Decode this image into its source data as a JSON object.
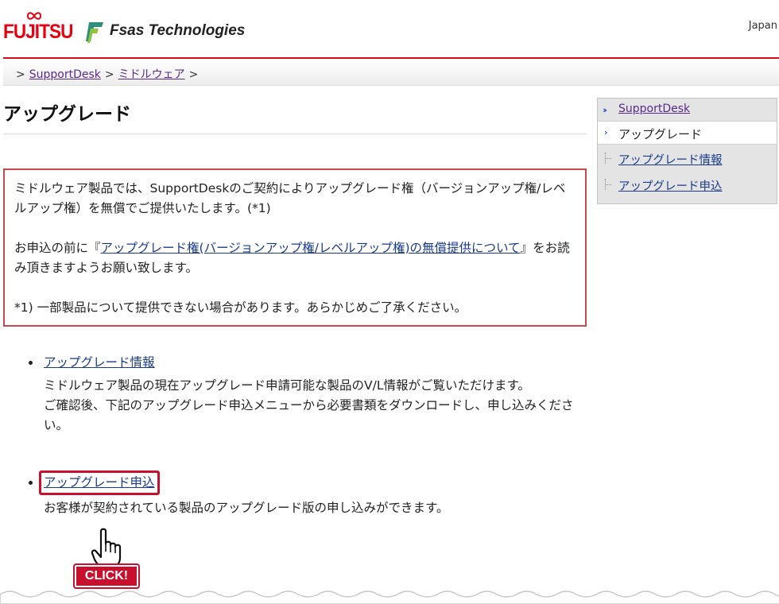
{
  "header": {
    "brand": "FUJITSU",
    "company": "Fsas Technologies",
    "region": "Japan",
    "colors": {
      "brand_red": "#e60012",
      "rule_red": "#d0111b"
    }
  },
  "breadcrumb": {
    "items": [
      {
        "label": "SupportDesk"
      },
      {
        "label": "ミドルウェア"
      }
    ],
    "separator": ">"
  },
  "page": {
    "title": "アップグレード"
  },
  "notice": {
    "line1": "ミドルウェア製品では、SupportDeskのご契約によりアップグレード権（バージョンアップ権/レベルアップ権）を無償でご提供いたします。(*1)",
    "line2_prefix": "お申込の前に『",
    "line2_link": "アップグレード権(バージョンアップ権/レベルアップ権)の無償提供について",
    "line2_suffix": "』をお読み頂きますようお願い致します。",
    "footnote": "*1) 一部製品について提供できない場合があります。あらかじめご了承ください。"
  },
  "items": [
    {
      "link": "アップグレード情報",
      "desc1": "ミドルウェア製品の現在アップグレード申請可能な製品のV/L情報がご覧いただけます。",
      "desc2": "ご確認後、下記のアップグレード申込メニューから必要書類をダウンロードし、申し込みください。"
    },
    {
      "link": "アップグレード申込",
      "desc1": "お客様が契約されている製品のアップグレード版の申し込みができます。"
    }
  ],
  "callout": {
    "label": "CLICK!",
    "color": "#c8102e",
    "icon": "pointing-hand-icon"
  },
  "sidenav": {
    "top": "SupportDesk",
    "current": "アップグレード",
    "sub": [
      "アップグレード情報",
      "アップグレード申込"
    ]
  }
}
